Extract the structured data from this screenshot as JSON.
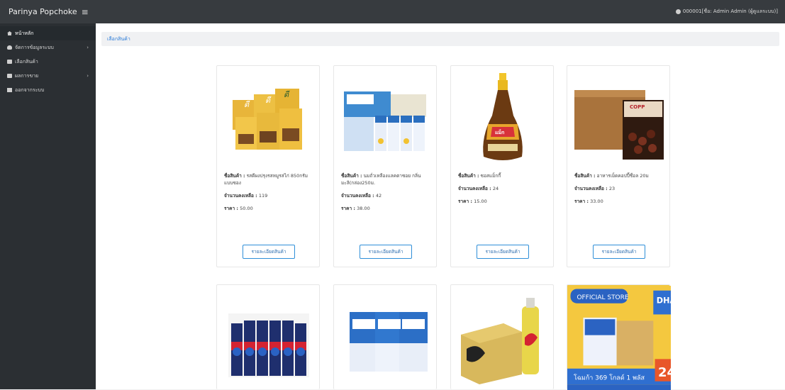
{
  "header": {
    "brand": "Parinya Popchoke",
    "menu_icon": "hamburger-icon",
    "user_text": "000001[ชื่อ: Admin Admin (ผู้ดูแลระบบ)]"
  },
  "sidebar": {
    "items": [
      {
        "label": "หน้าหลัก",
        "icon": "home-icon"
      },
      {
        "label": "จัดการข้อมูลระบบ",
        "icon": "user-icon",
        "arrow": "›"
      },
      {
        "label": "เลือกสินค้า",
        "icon": "shopping-icon"
      },
      {
        "label": "ผลการขาย",
        "icon": "cart-icon",
        "arrow": "›"
      },
      {
        "label": "ออกจากระบบ",
        "icon": "logout-icon"
      }
    ]
  },
  "breadcrumb": {
    "label": "เลือกสินค้า"
  },
  "products": [
    {
      "name_label": "ชื่อสินค้า :",
      "name": "รสดีผงปรุงรสหมูรสไก่ 850กรัมแบบซอง",
      "stock_label": "จำนวนคงเหลือ :",
      "stock": "119",
      "price_label": "ราคา :",
      "price": "50.00",
      "button": "รายละเอียดสินค้า",
      "image": "seasoning-packs-image"
    },
    {
      "name_label": "ชื่อสินค้า :",
      "name": "นมถั่วเหลืองแลคตาซอย กลิ่นมะลิ(กล่อง250ม.",
      "stock_label": "จำนวนคงเหลือ :",
      "stock": "42",
      "price_label": "ราคา :",
      "price": "38.00",
      "button": "รายละเอียดสินค้า",
      "image": "soymilk-box-image"
    },
    {
      "name_label": "ชื่อสินค้า :",
      "name": "ซอสแม็กกี้",
      "stock_label": "จำนวนคงเหลือ :",
      "stock": "24",
      "price_label": "ราคา :",
      "price": "15.00",
      "button": "รายละเอียดสินค้า",
      "image": "sauce-bottle-image"
    },
    {
      "name_label": "ชื่อสินค้า :",
      "name": "อาหารเม็ดคอปปี้ชื่อล 20ม",
      "stock_label": "จำนวนคงเหลือ :",
      "stock": "23",
      "price_label": "ราคา :",
      "price": "33.00",
      "button": "รายละเอียดสินค้า",
      "image": "snack-box-image"
    },
    {
      "image": "pepsi-bottles-image"
    },
    {
      "image": "milk-packs-image"
    },
    {
      "image": "sponsor-drink-image"
    },
    {
      "image": "dha-milk-promo-image",
      "promo_badge": "DHA",
      "promo_number": "24",
      "promo_text": "โฉมก้า 369 โกลด์ 1 พลัส"
    }
  ]
}
